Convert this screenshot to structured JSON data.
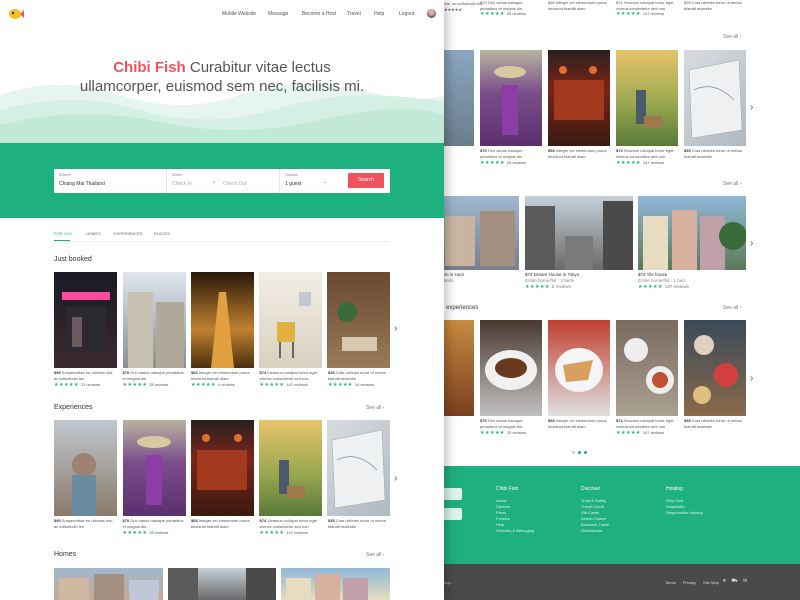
{
  "nav": {
    "links": [
      "Mobile Website",
      "Message",
      "Become a Host",
      "Travel",
      "Help",
      "Logout"
    ]
  },
  "hero": {
    "brand": "Chibi Fish",
    "tagline_1": "Curabitur vitae lectus",
    "tagline_2": "ullamcorper, euismod sem nec, facilisis mi."
  },
  "search": {
    "where_label": "Where",
    "where_value": "Chiang Mai Thailand",
    "when_label": "When",
    "checkin_placeholder": "Check In",
    "checkout_placeholder": "Check Out",
    "guests_label": "Guests",
    "guests_value": "1 guest",
    "button": "Search"
  },
  "tabs": [
    "FOR YOU",
    "HOMES",
    "EXPERIENCES",
    "PLACES"
  ],
  "sections": {
    "just_booked": "Just booked",
    "experiences": "Experiences",
    "homes": "Homes",
    "see_all": "See all"
  },
  "just_booked_cards": [
    {
      "price": "$90",
      "text": "Suspendisse eu ultricies nisi, ac sollicitudin leo",
      "reviews": "21 reviews"
    },
    {
      "price": "$70",
      "text": "Orci varius natoque penatibus et magnis dis",
      "reviews": "25 reviews"
    },
    {
      "price": "$66",
      "text": "Integer vel elementum purus, tincidunt blandit diam",
      "reviews": "4 reviews"
    },
    {
      "price": "$74",
      "text": "Vivamus volutpat tortor eget viverra consectetur sed non",
      "reviews": "147 reviews"
    },
    {
      "price": "$35",
      "text": "Cras ultricies tortor ut metus blandit molestie",
      "reviews": "14 reviews"
    }
  ],
  "experience_cards": [
    {
      "price": "$90",
      "text": "Suspendisse eu ultricies nisi, ac sollicitudin leo",
      "reviews": ""
    },
    {
      "price": "$70",
      "text": "Orci varius natoque penatibus et magnis dis",
      "reviews": "25 reviews"
    },
    {
      "price": "$66",
      "text": "Integer vel elementum purus, tincidunt blandit diam",
      "reviews": ""
    },
    {
      "price": "$74",
      "text": "Vivamus volutpat tortor eget viverra consectetur sed non",
      "reviews": "147 reviews"
    },
    {
      "price": "$35",
      "text": "Cras ultricies tortor ut metus blandit molestie",
      "reviews": ""
    }
  ],
  "back_top_cards": [
    {
      "price": "$70",
      "text": "Orci varius natoque penatibus et magnis dis",
      "reviews": "25 reviews"
    },
    {
      "price": "$66",
      "text": "Integer vel elementum purus, tincidunt blandit diam",
      "reviews": ""
    },
    {
      "price": "$74",
      "text": "Vivamus volutpat tortor eget viverra consectetur sed non",
      "reviews": "147 reviews"
    },
    {
      "price": "$35",
      "text": "Cras ultricies tortor ut metus blandit molestie",
      "reviews": ""
    }
  ],
  "back_homes": [
    {
      "title": "obin in Hoa!",
      "sub": "3 beds",
      "reviews": ""
    },
    {
      "title": "$74 Dream House in Tokyo",
      "sub": "Entire home/flat · 2 beds",
      "reviews": "5 reviews"
    },
    {
      "title": "$74 Tile house",
      "sub": "Entire home/flat · 1 bed",
      "reviews": "147 reviews"
    }
  ],
  "back_exp_title": "experiences",
  "footer": {
    "col1_title": "Chibi Fish",
    "col1": [
      "About",
      "Careers",
      "Press",
      "Policies",
      "Help",
      "Diversity & Belonging"
    ],
    "col2_title": "Discover",
    "col2": [
      "Trust & Safety",
      "Travel Credit",
      "Gift Cards",
      "Airbnb Citizen",
      "Business Travel",
      "Guidebooks"
    ],
    "col3_title": "Hosting",
    "col3": [
      "Why Host",
      "Hospitality",
      "Responsible Hosting"
    ],
    "bottom_left": "ings",
    "bottom_links": [
      "Terms",
      "Privacy",
      "Site Map"
    ]
  },
  "colors": {
    "accent": "#f0525f",
    "brand_green": "#1eb07e",
    "dark": "#4a4a4a"
  }
}
